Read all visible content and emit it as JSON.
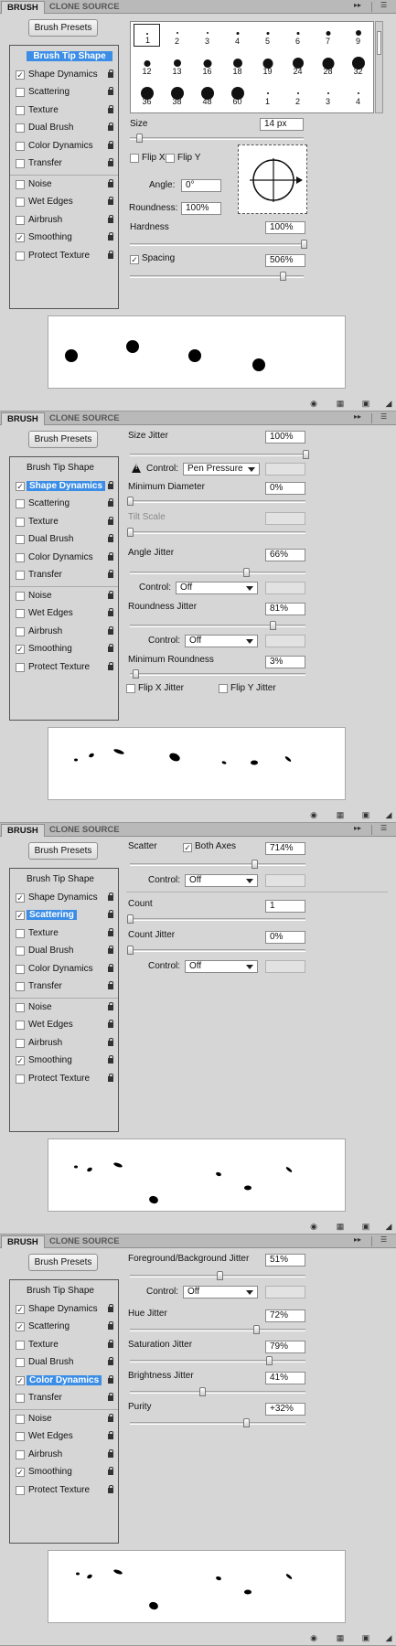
{
  "common": {
    "tab_brush": "BRUSH",
    "tab_clone_source": "CLONE SOURCE",
    "brush_presets": "Brush Presets",
    "double_arrow": "▸▸",
    "menu_icon": "☰",
    "footer_icons": [
      "eye-icon",
      "grid-icon",
      "new-preset-icon",
      "resize-grip-icon"
    ]
  },
  "sidebar_labels": {
    "brush_tip_shape": "Brush Tip Shape",
    "shape_dynamics": "Shape Dynamics",
    "scattering": "Scattering",
    "texture": "Texture",
    "dual_brush": "Dual Brush",
    "color_dynamics": "Color Dynamics",
    "transfer": "Transfer",
    "noise": "Noise",
    "wet_edges": "Wet Edges",
    "airbrush": "Airbrush",
    "smoothing": "Smoothing",
    "protect_texture": "Protect Texture"
  },
  "panels": [
    {
      "selected": "brush_tip_shape",
      "checked": [
        "shape_dynamics",
        "smoothing"
      ],
      "tips": [
        {
          "num": "1",
          "size": 2
        },
        {
          "num": "2",
          "size": 2
        },
        {
          "num": "3",
          "size": 2
        },
        {
          "num": "4",
          "size": 3
        },
        {
          "num": "5",
          "size": 3
        },
        {
          "num": "6",
          "size": 3
        },
        {
          "num": "7",
          "size": 5
        },
        {
          "num": "9",
          "size": 6
        },
        {
          "num": "12",
          "size": 7
        },
        {
          "num": "13",
          "size": 8
        },
        {
          "num": "16",
          "size": 9
        },
        {
          "num": "18",
          "size": 10
        },
        {
          "num": "19",
          "size": 11
        },
        {
          "num": "24",
          "size": 12
        },
        {
          "num": "28",
          "size": 13
        },
        {
          "num": "32",
          "size": 14
        },
        {
          "num": "36",
          "size": 14
        },
        {
          "num": "38",
          "size": 14
        },
        {
          "num": "48",
          "size": 14
        },
        {
          "num": "60",
          "size": 14
        },
        {
          "num": "1",
          "size": 2
        },
        {
          "num": "2",
          "size": 2
        },
        {
          "num": "3",
          "size": 2
        },
        {
          "num": "4",
          "size": 2
        }
      ],
      "size_label": "Size",
      "size_value": "14 px",
      "flip_x": "Flip X",
      "flip_y": "Flip Y",
      "angle_label": "Angle:",
      "angle_value": "0°",
      "roundness_label": "Roundness:",
      "roundness_value": "100%",
      "hardness_label": "Hardness",
      "hardness_value": "100%",
      "spacing_label": "Spacing",
      "spacing_value": "506%",
      "sliders": {
        "size": 0.05,
        "hardness": 1.0,
        "spacing": 0.88
      }
    },
    {
      "selected": "shape_dynamics",
      "checked": [
        "shape_dynamics",
        "smoothing"
      ],
      "size_jitter_label": "Size Jitter",
      "size_jitter_value": "100%",
      "control_label": "Control:",
      "control_pen_value": "Pen Pressure",
      "min_diameter_label": "Minimum Diameter",
      "min_diameter_value": "0%",
      "tilt_scale_label": "Tilt Scale",
      "angle_jitter_label": "Angle Jitter",
      "angle_jitter_value": "66%",
      "control_off": "Off",
      "roundness_jitter_label": "Roundness Jitter",
      "roundness_jitter_value": "81%",
      "min_roundness_label": "Minimum Roundness",
      "min_roundness_value": "3%",
      "flip_x_jitter": "Flip X Jitter",
      "flip_y_jitter": "Flip Y Jitter",
      "sliders": {
        "size_jitter": 1.0,
        "min_diameter": 0.0,
        "angle_jitter": 0.66,
        "roundness_jitter": 0.81,
        "min_roundness": 0.03
      }
    },
    {
      "selected": "scattering",
      "checked": [
        "shape_dynamics",
        "scattering",
        "smoothing"
      ],
      "scatter_label": "Scatter",
      "both_axes_label": "Both Axes",
      "scatter_value": "714%",
      "control_label": "Control:",
      "control_off": "Off",
      "count_label": "Count",
      "count_value": "1",
      "count_jitter_label": "Count Jitter",
      "count_jitter_value": "0%",
      "sliders": {
        "scatter": 0.71,
        "count": 0.0,
        "count_jitter": 0.0
      }
    },
    {
      "selected": "color_dynamics",
      "checked": [
        "shape_dynamics",
        "scattering",
        "color_dynamics",
        "smoothing"
      ],
      "fg_bg_jitter_label": "Foreground/Background Jitter",
      "fg_bg_jitter_value": "51%",
      "control_label": "Control:",
      "control_off": "Off",
      "hue_jitter_label": "Hue Jitter",
      "hue_jitter_value": "72%",
      "saturation_jitter_label": "Saturation Jitter",
      "saturation_jitter_value": "79%",
      "brightness_jitter_label": "Brightness Jitter",
      "brightness_jitter_value": "41%",
      "purity_label": "Purity",
      "purity_value": "+32%",
      "sliders": {
        "fg_bg_jitter": 0.51,
        "hue_jitter": 0.72,
        "saturation_jitter": 0.79,
        "brightness_jitter": 0.41,
        "purity": 0.66
      }
    }
  ]
}
